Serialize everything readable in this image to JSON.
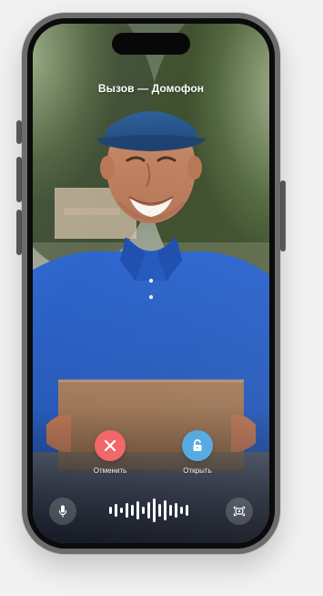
{
  "call": {
    "title": "Вызов — Домофон"
  },
  "actions": {
    "cancel_label": "Отменить",
    "open_label": "Открыть"
  },
  "icons": {
    "cancel": "close-icon",
    "open": "unlock-icon",
    "microphone": "microphone-icon",
    "waveform": "audio-waveform-icon",
    "camera_switch": "camera-switch-icon"
  },
  "colors": {
    "cancel": "#f16666",
    "open": "#52a8df",
    "text": "#ffffff"
  }
}
